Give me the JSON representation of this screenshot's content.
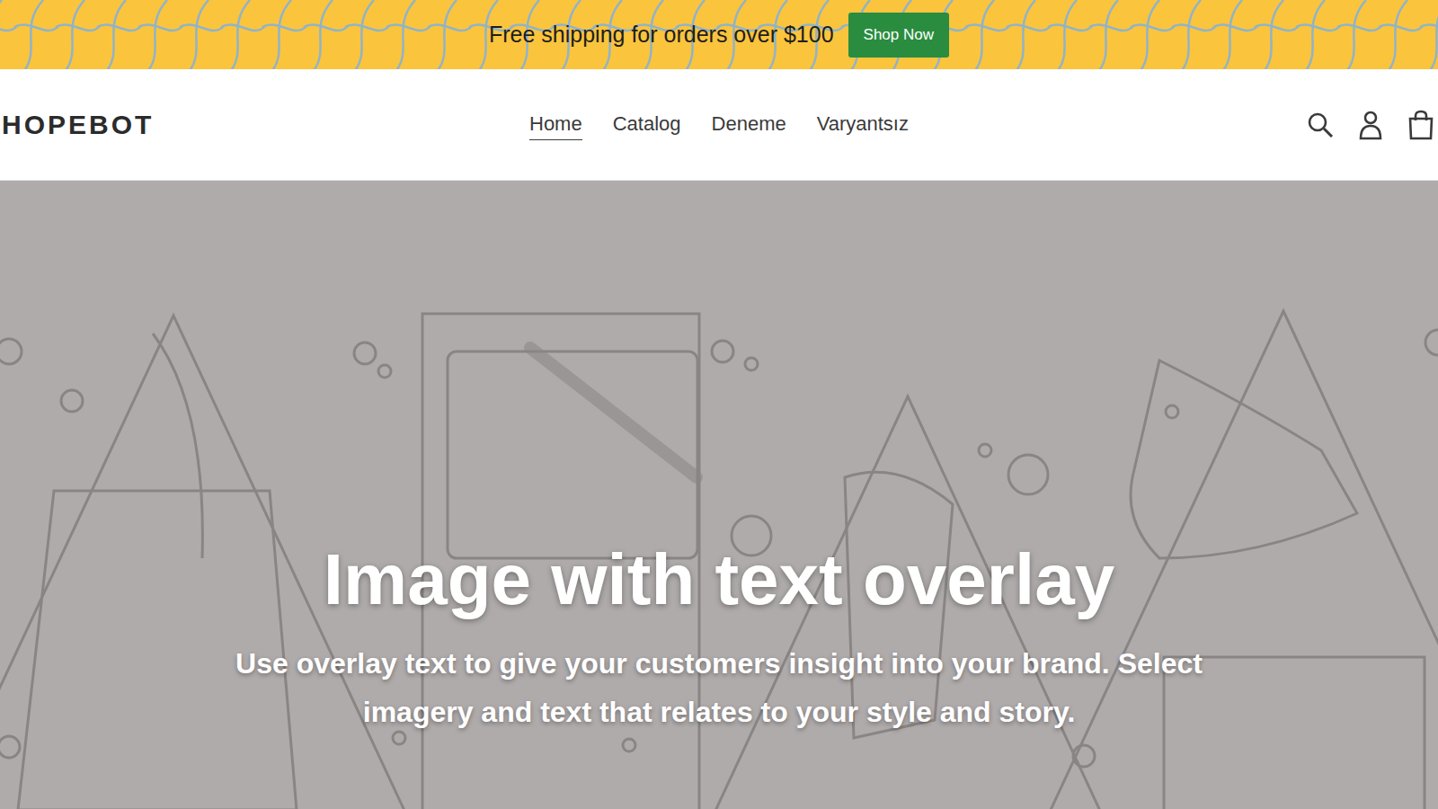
{
  "announcement": {
    "text": "Free shipping for orders over $100",
    "button": "Shop Now"
  },
  "header": {
    "logo": "HOPEBOT",
    "nav": [
      {
        "label": "Home",
        "selected": true
      },
      {
        "label": "Catalog",
        "selected": false
      },
      {
        "label": "Deneme",
        "selected": false
      },
      {
        "label": "Varyantsız",
        "selected": false
      }
    ]
  },
  "hero": {
    "title": "Image with text overlay",
    "text": "Use overlay text to give your customers insight into your brand. Select imagery and text that relates to your style and story."
  }
}
